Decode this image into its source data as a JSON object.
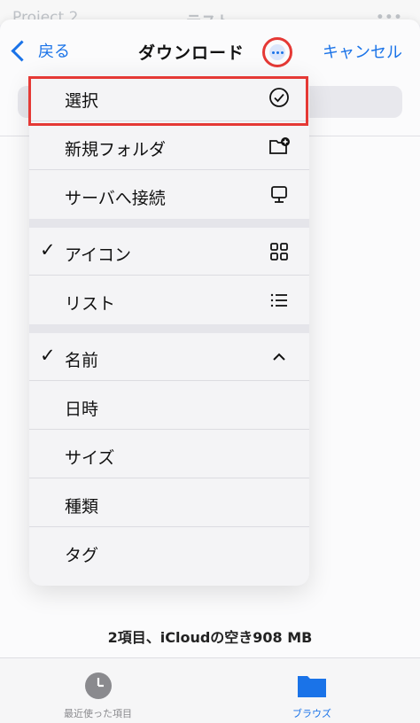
{
  "background": {
    "back_text": "Project 2",
    "title": "テスト",
    "more_text": "•••"
  },
  "navbar": {
    "back_label": "戻る",
    "title": "ダウンロード",
    "cancel_label": "キャンセル"
  },
  "menu": {
    "items": [
      {
        "label": "選択",
        "icon": "select-circle-check-icon"
      },
      {
        "label": "新規フォルダ",
        "icon": "new-folder-icon"
      },
      {
        "label": "サーバへ接続",
        "icon": "server-connect-icon"
      },
      {
        "label": "アイコン",
        "checked": true,
        "icon": "grid-icon"
      },
      {
        "label": "リスト",
        "icon": "list-icon"
      },
      {
        "label": "名前",
        "checked": true,
        "icon": "chevron-up-icon"
      },
      {
        "label": "日時"
      },
      {
        "label": "サイズ"
      },
      {
        "label": "種類"
      },
      {
        "label": "タグ"
      }
    ],
    "check_mark": "✓"
  },
  "footer": {
    "status_text": "2項目、iCloudの空き908 MB"
  },
  "tabbar": {
    "recent_label": "最近使った項目",
    "browse_label": "ブラウズ"
  },
  "colors": {
    "accent": "#1a73e8",
    "highlight": "#e53935"
  }
}
